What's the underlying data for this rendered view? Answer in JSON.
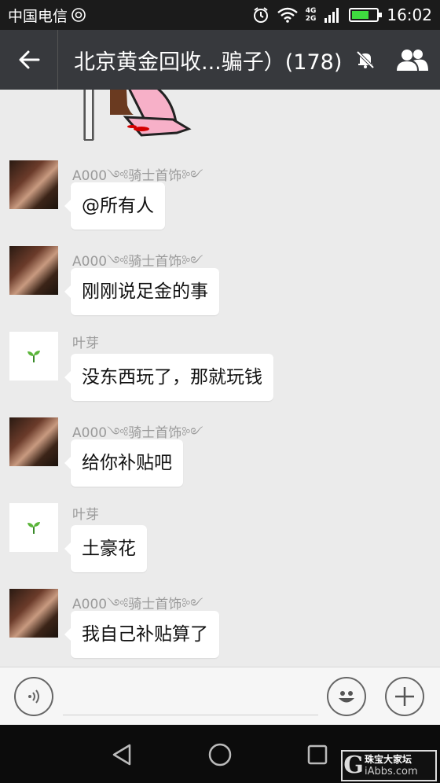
{
  "status_bar": {
    "carrier": "中国电信",
    "net_top": "4G",
    "net_bottom": "2G",
    "time": "16:02"
  },
  "header": {
    "title": "北京黄金回收...骗子）(178)"
  },
  "messages": [
    {
      "sender": "A000༺骑士首饰༻",
      "text": "@所有人",
      "avatar": "photo-avatar"
    },
    {
      "sender": "A000༺骑士首饰༻",
      "text": "刚刚说足金的事",
      "avatar": "photo-avatar"
    },
    {
      "sender": "叶芽",
      "text": "没东西玩了，那就玩钱",
      "avatar": "sprout-avatar"
    },
    {
      "sender": "A000༺骑士首饰༻",
      "text": "给你补贴吧",
      "avatar": "photo-avatar"
    },
    {
      "sender": "叶芽",
      "text": "土豪花",
      "avatar": "sprout-avatar"
    },
    {
      "sender": "A000༺骑士首饰༻",
      "text": "我自己补贴算了",
      "avatar": "photo-avatar"
    }
  ],
  "watermark": {
    "letter": "G",
    "name": "珠宝大家坛",
    "site": "iAbbs.com"
  },
  "colors": {
    "header_bg": "#37393d",
    "chat_bg": "#ebebeb",
    "bubble_bg": "#ffffff",
    "sender_text": "#9a9a9a"
  }
}
